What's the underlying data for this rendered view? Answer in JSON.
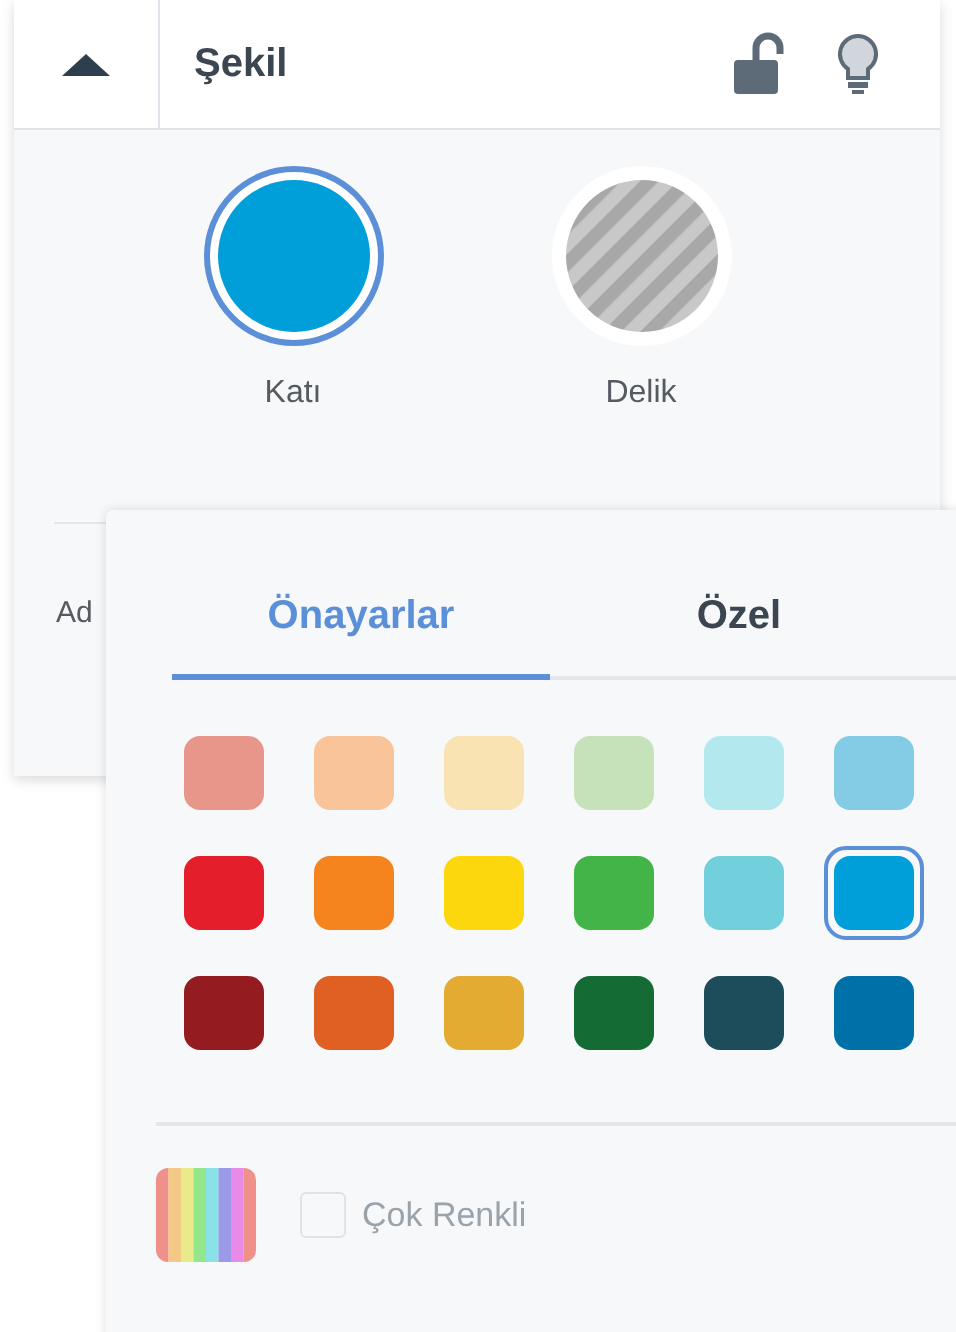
{
  "header": {
    "title": "Şekil"
  },
  "shapes": [
    {
      "kind": "solid",
      "label": "Katı",
      "selected": true
    },
    {
      "kind": "hole",
      "label": "Delik",
      "selected": false
    }
  ],
  "steps": {
    "label": "Ad"
  },
  "popover": {
    "tabs": [
      {
        "label": "Önayarlar",
        "selected": true
      },
      {
        "label": "Özel",
        "selected": false
      }
    ],
    "swatches": [
      {
        "color": "#e8968a",
        "selected": false
      },
      {
        "color": "#f9c49a",
        "selected": false
      },
      {
        "color": "#f9e3b3",
        "selected": false
      },
      {
        "color": "#c6e2bb",
        "selected": false
      },
      {
        "color": "#b3e8ef",
        "selected": false
      },
      {
        "color": "#84cbe5",
        "selected": false
      },
      {
        "color": "#e41e2b",
        "selected": false
      },
      {
        "color": "#f5841f",
        "selected": false
      },
      {
        "color": "#fcd70e",
        "selected": false
      },
      {
        "color": "#43b548",
        "selected": false
      },
      {
        "color": "#72cfdc",
        "selected": false
      },
      {
        "color": "#009fda",
        "selected": true
      },
      {
        "color": "#941b20",
        "selected": false
      },
      {
        "color": "#e05f23",
        "selected": false
      },
      {
        "color": "#e3ab32",
        "selected": false
      },
      {
        "color": "#146b33",
        "selected": false
      },
      {
        "color": "#1d4d5a",
        "selected": false
      },
      {
        "color": "#0070a8",
        "selected": false
      }
    ],
    "multicolor": {
      "label": "Çok Renkli",
      "checked": false,
      "disabled": true
    }
  }
}
